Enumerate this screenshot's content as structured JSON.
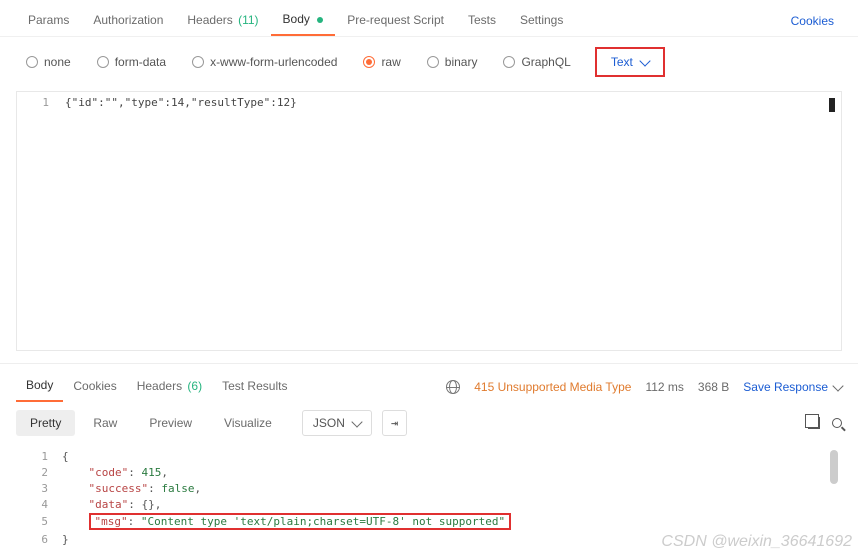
{
  "tabs": {
    "params": "Params",
    "auth": "Authorization",
    "headers": "Headers",
    "headers_count": "(11)",
    "body": "Body",
    "prerequest": "Pre-request Script",
    "tests": "Tests",
    "settings": "Settings",
    "cookies": "Cookies"
  },
  "bodyTypes": {
    "none": "none",
    "formdata": "form-data",
    "xwww": "x-www-form-urlencoded",
    "raw": "raw",
    "binary": "binary",
    "graphql": "GraphQL",
    "textDropdown": "Text"
  },
  "request": {
    "line1_num": "1",
    "line1_code": "{\"id\":\"\",\"type\":14,\"resultType\":12}"
  },
  "respTabs": {
    "body": "Body",
    "cookies": "Cookies",
    "headers": "Headers",
    "headers_count": "(6)",
    "testResults": "Test Results"
  },
  "status": {
    "text": "415 Unsupported Media Type",
    "time": "112 ms",
    "size": "368 B",
    "save": "Save Response"
  },
  "respToolbar": {
    "pretty": "Pretty",
    "raw": "Raw",
    "preview": "Preview",
    "visualize": "Visualize",
    "format": "JSON"
  },
  "respBody": {
    "l1n": "1",
    "l1": "{",
    "l2n": "2",
    "l2_indent": "    ",
    "l2_key": "\"code\"",
    "l2_colon": ": ",
    "l2_val": "415",
    "l2_comma": ",",
    "l3n": "3",
    "l3_indent": "    ",
    "l3_key": "\"success\"",
    "l3_colon": ": ",
    "l3_val": "false",
    "l3_comma": ",",
    "l4n": "4",
    "l4_indent": "    ",
    "l4_key": "\"data\"",
    "l4_colon": ": ",
    "l4_val": "{}",
    "l4_comma": ",",
    "l5n": "5",
    "l5_indent": "    ",
    "l5_key": "\"msg\"",
    "l5_colon": ": ",
    "l5_val": "\"Content type 'text/plain;charset=UTF-8' not supported\"",
    "l6n": "6",
    "l6": "}"
  },
  "watermark": "CSDN @weixin_36641692"
}
